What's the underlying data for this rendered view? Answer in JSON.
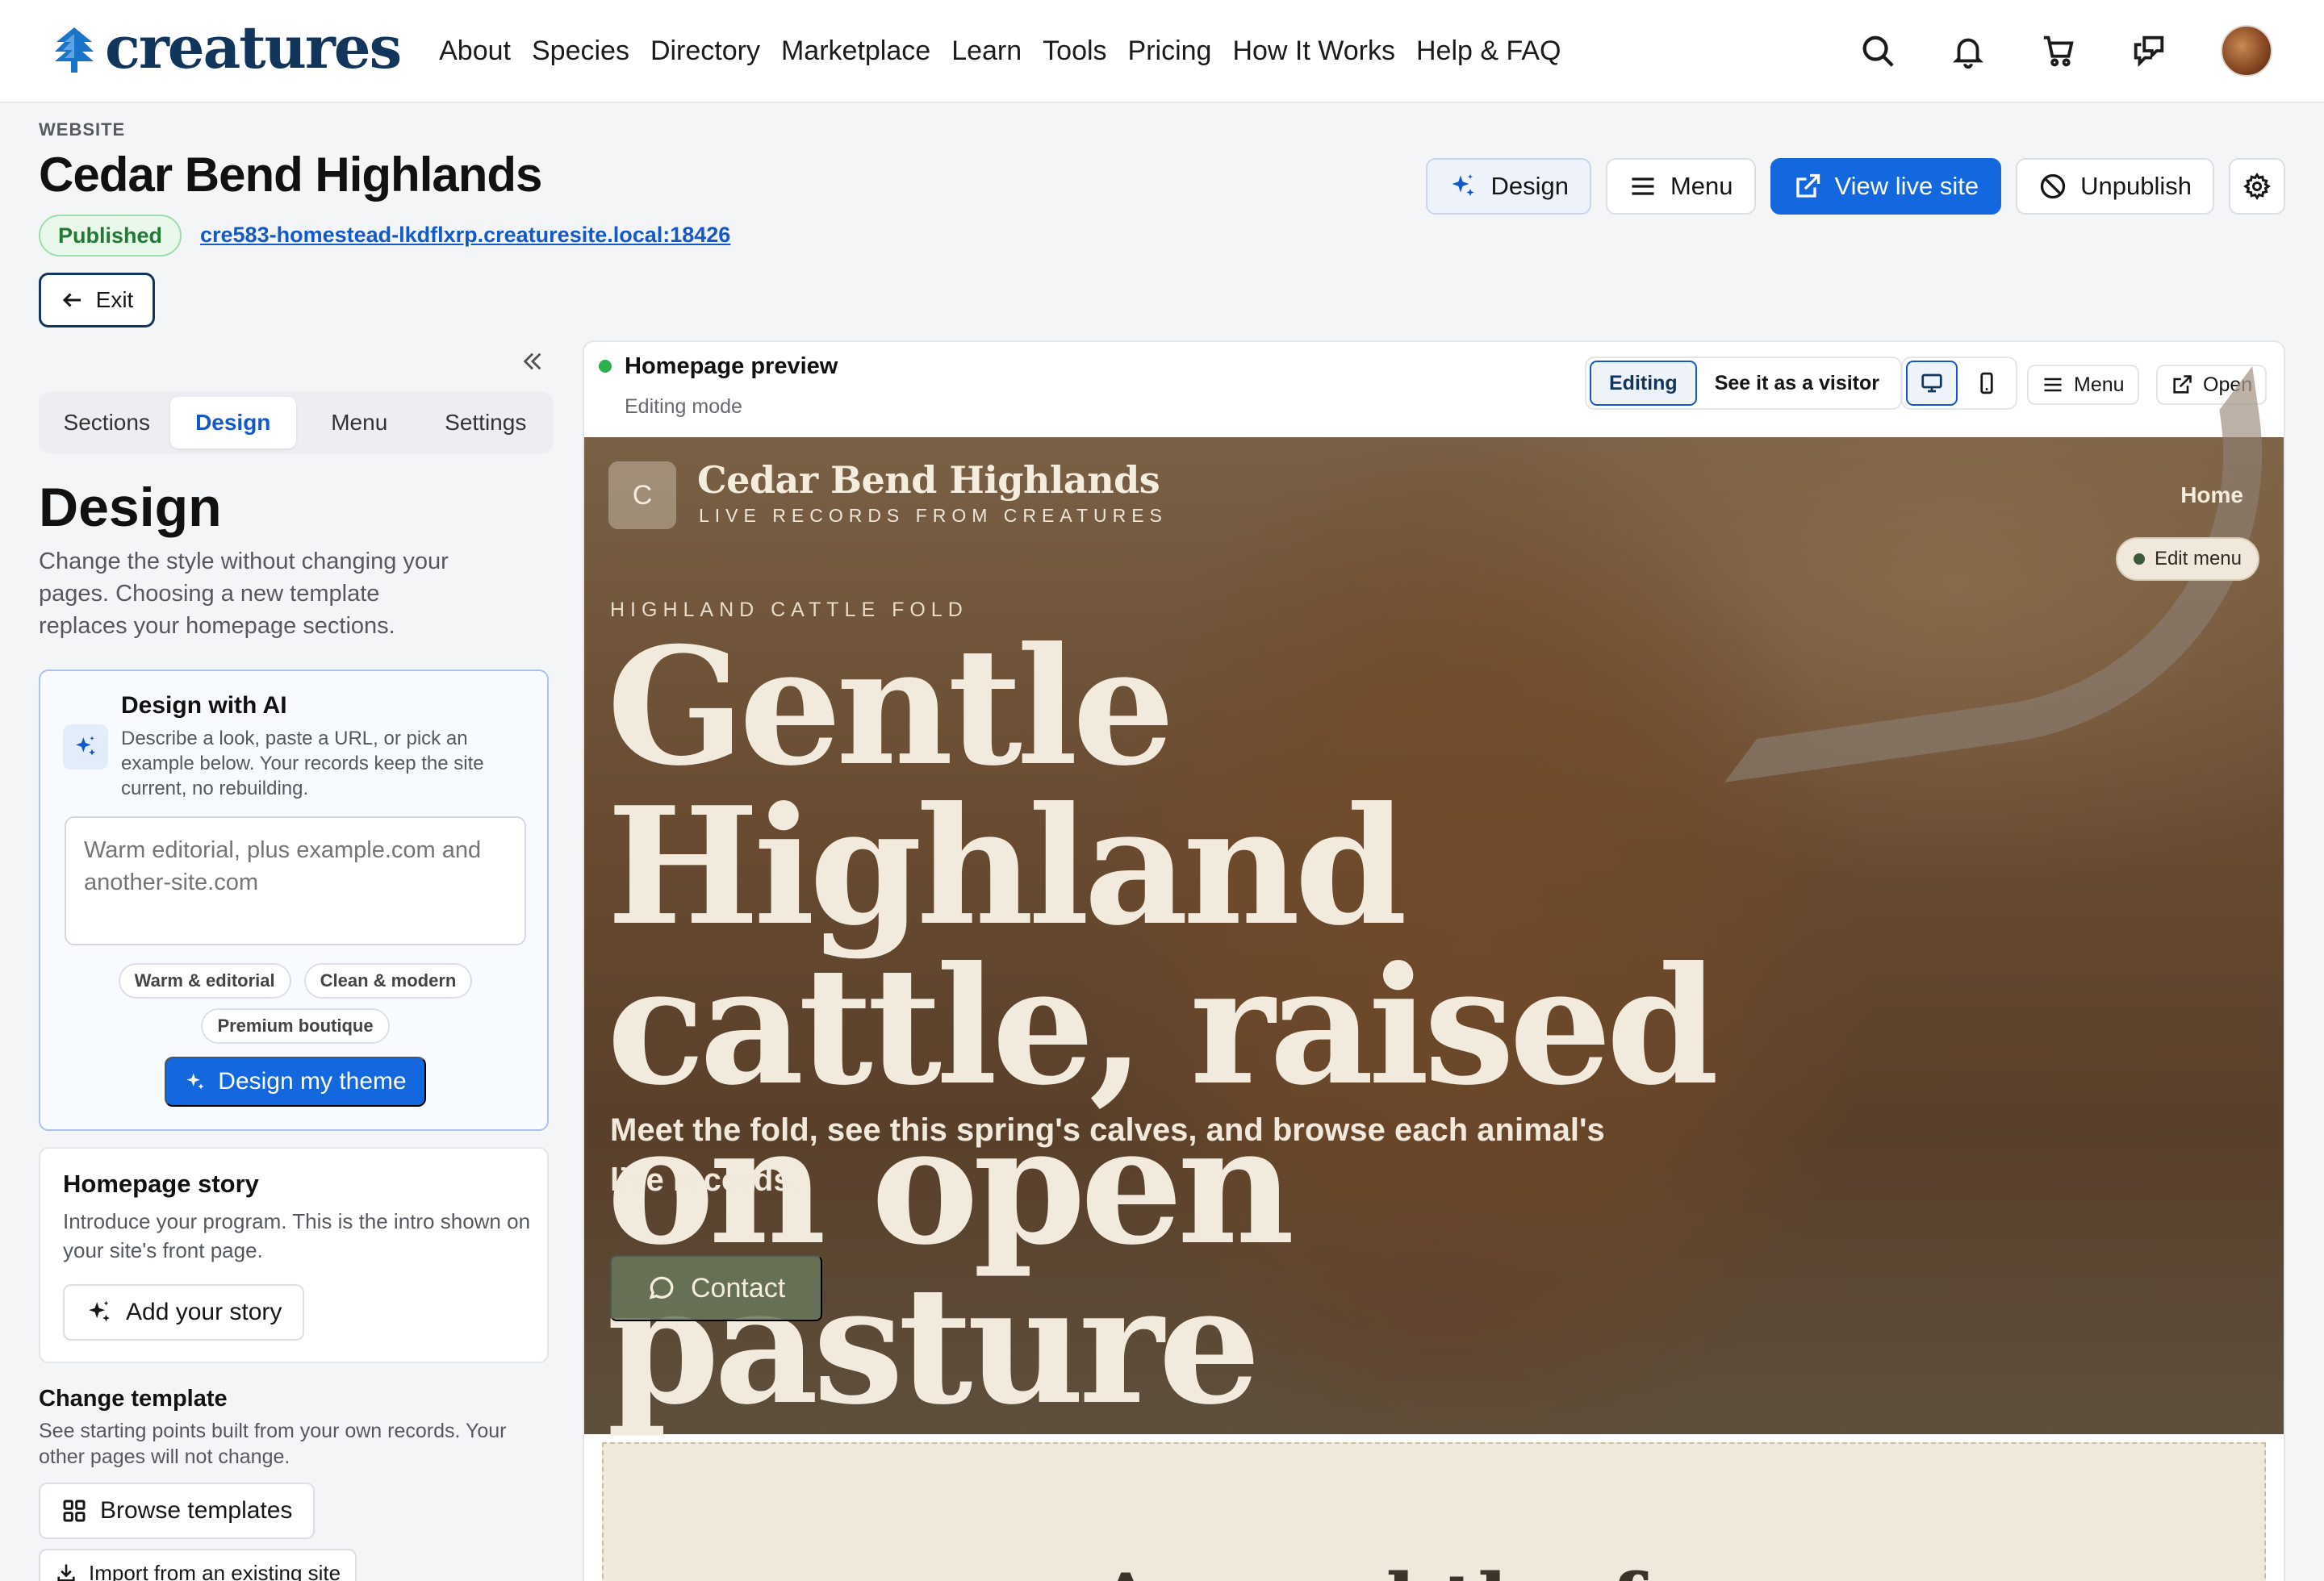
{
  "app": {
    "brand": "creatures",
    "nav": [
      "About",
      "Species",
      "Directory",
      "Marketplace",
      "Learn",
      "Tools",
      "Pricing",
      "How It Works",
      "Help & FAQ"
    ],
    "icons": [
      "search-icon",
      "bell-icon",
      "cart-icon",
      "messages-icon"
    ]
  },
  "page": {
    "label": "WEBSITE",
    "title": "Cedar Bend Highlands",
    "status": "Published",
    "url": "cre583-homestead-lkdflxrp.creaturesite.local:18426",
    "exit_label": "Exit"
  },
  "actions": {
    "design": "Design",
    "menu": "Menu",
    "view_live": "View live site",
    "unpublish": "Unpublish"
  },
  "sidebar": {
    "tabs": [
      "Sections",
      "Design",
      "Menu",
      "Settings"
    ],
    "active_tab": "Design",
    "title": "Design",
    "description": "Change the style without changing your pages. Choosing a new template replaces your homepage sections.",
    "ai": {
      "title": "Design with AI",
      "description": "Describe a look, paste a URL, or pick an example below. Your records keep the site current, no rebuilding.",
      "placeholder": "Warm editorial, plus example.com and another-site.com",
      "chips": [
        "Warm & editorial",
        "Clean & modern",
        "Premium boutique"
      ],
      "submit": "Design my theme"
    },
    "story": {
      "title": "Homepage story",
      "description": "Introduce your program. This is the intro shown on your site's front page.",
      "button": "Add your story"
    },
    "template": {
      "title": "Change template",
      "description": "See starting points built from your own records. Your other pages will not change.",
      "browse": "Browse templates",
      "import": "Import from an existing site"
    }
  },
  "preview": {
    "title": "Homepage preview",
    "mode": "Editing mode",
    "toggle": [
      "Editing",
      "See it as a visitor"
    ],
    "menu": "Menu",
    "open": "Open",
    "hero": {
      "badge": "C",
      "site_name": "Cedar Bend Highlands",
      "tagline": "LIVE RECORDS FROM CREATURES",
      "home": "Home",
      "edit_menu": "Edit menu",
      "kicker": "HIGHLAND CATTLE FOLD",
      "heading": "Gentle Highland cattle, raised on open pasture",
      "subtitle": "Meet the fold, see this spring's calves, and browse each animal's live records.",
      "contact": "Contact"
    },
    "next_heading": "Around the f"
  },
  "colors": {
    "primary": "#1368e0",
    "brand": "#12355b",
    "published": "#1f7a34",
    "hero_text": "#f2ebdd"
  }
}
